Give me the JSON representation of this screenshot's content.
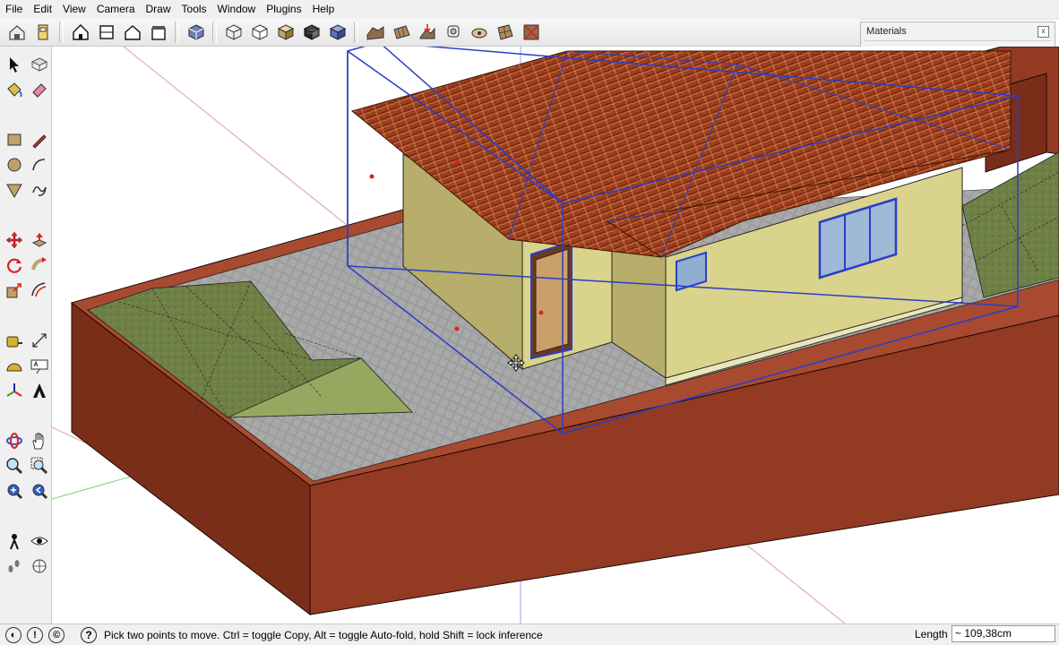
{
  "menu": [
    "File",
    "Edit",
    "View",
    "Camera",
    "Draw",
    "Tools",
    "Window",
    "Plugins",
    "Help"
  ],
  "toolbar": {
    "buttons": [
      {
        "name": "get-current-view-button",
        "icon": "house-camera-icon"
      },
      {
        "name": "share-model-button",
        "icon": "share-model-icon"
      },
      {
        "name": "iso-view-button",
        "icon": "house-iso-icon"
      },
      {
        "name": "top-view-button",
        "icon": "house-top-icon"
      },
      {
        "name": "front-view-button",
        "icon": "house-front-icon"
      },
      {
        "name": "right-view-button",
        "icon": "house-right-icon"
      },
      {
        "name": "xray-button",
        "icon": "cube-xray-icon"
      },
      {
        "name": "wireframe-button",
        "icon": "cube-wireframe-icon"
      },
      {
        "name": "hidden-line-button",
        "icon": "cube-hidden-line-icon"
      },
      {
        "name": "shaded-button",
        "icon": "cube-shaded-icon"
      },
      {
        "name": "shaded-textures-button",
        "icon": "cube-textured-icon"
      },
      {
        "name": "monochrome-button",
        "icon": "cube-monochrome-icon"
      },
      {
        "name": "sandbox-contours-button",
        "icon": "terrain-contours-icon"
      },
      {
        "name": "sandbox-scratch-button",
        "icon": "terrain-grid-icon"
      },
      {
        "name": "smoove-button",
        "icon": "smoove-icon"
      },
      {
        "name": "stamp-button",
        "icon": "stamp-icon"
      },
      {
        "name": "drape-button",
        "icon": "drape-icon"
      },
      {
        "name": "add-detail-button",
        "icon": "add-detail-icon"
      },
      {
        "name": "flip-edge-button",
        "icon": "flip-edge-icon"
      }
    ]
  },
  "materials": {
    "title": "Materials",
    "close_label": "x"
  },
  "left_tools": [
    {
      "name": "select-tool",
      "icon": "arrow-cursor-icon"
    },
    {
      "name": "make-component-tool",
      "icon": "component-icon"
    },
    {
      "name": "paint-bucket-tool",
      "icon": "paint-bucket-icon"
    },
    {
      "name": "eraser-tool",
      "icon": "eraser-icon"
    },
    {
      "name": "rectangle-tool",
      "icon": "rectangle-icon"
    },
    {
      "name": "line-tool",
      "icon": "pencil-icon"
    },
    {
      "name": "circle-tool",
      "icon": "circle-icon"
    },
    {
      "name": "arc-tool",
      "icon": "arc-icon"
    },
    {
      "name": "polygon-tool",
      "icon": "polygon-icon"
    },
    {
      "name": "freehand-tool",
      "icon": "freehand-icon"
    },
    {
      "name": "move-tool",
      "icon": "move-icon"
    },
    {
      "name": "push-pull-tool",
      "icon": "push-pull-icon"
    },
    {
      "name": "rotate-tool",
      "icon": "rotate-icon"
    },
    {
      "name": "follow-me-tool",
      "icon": "follow-me-icon"
    },
    {
      "name": "scale-tool",
      "icon": "scale-icon"
    },
    {
      "name": "offset-tool",
      "icon": "offset-icon"
    },
    {
      "name": "tape-measure-tool",
      "icon": "tape-measure-icon"
    },
    {
      "name": "dimension-tool",
      "icon": "dimension-icon"
    },
    {
      "name": "protractor-tool",
      "icon": "protractor-icon"
    },
    {
      "name": "text-tool",
      "icon": "text-icon"
    },
    {
      "name": "axes-tool",
      "icon": "axes-icon"
    },
    {
      "name": "3d-text-tool",
      "icon": "3d-text-icon"
    },
    {
      "name": "orbit-tool",
      "icon": "orbit-icon"
    },
    {
      "name": "pan-tool",
      "icon": "hand-icon"
    },
    {
      "name": "zoom-tool",
      "icon": "magnifier-icon"
    },
    {
      "name": "zoom-window-tool",
      "icon": "zoom-window-icon"
    },
    {
      "name": "zoom-extents-tool",
      "icon": "zoom-extents-icon"
    },
    {
      "name": "previous-view-tool",
      "icon": "previous-view-icon"
    },
    {
      "name": "position-camera-tool",
      "icon": "position-camera-icon"
    },
    {
      "name": "look-around-tool",
      "icon": "eye-icon"
    },
    {
      "name": "walk-tool",
      "icon": "footprints-icon"
    },
    {
      "name": "section-plane-tool",
      "icon": "section-plane-icon"
    }
  ],
  "status": {
    "message": "Pick two points to move.  Ctrl = toggle Copy, Alt = toggle Auto-fold, hold Shift = lock inference",
    "length_label": "Length",
    "length_value": "~ 109,38cm",
    "icons": [
      "geo-location-icon",
      "credits-icon",
      "user-icon",
      "help-icon"
    ]
  },
  "colors": {
    "wall_front": "#933a22",
    "wall_side": "#7a2e19",
    "wall_top": "#a84a30",
    "paving": "#9a9a9a",
    "grass": "#6f8046",
    "house_wall": "#d9d38c",
    "roof": "#b65a34",
    "selection": "#2a3ec8"
  }
}
